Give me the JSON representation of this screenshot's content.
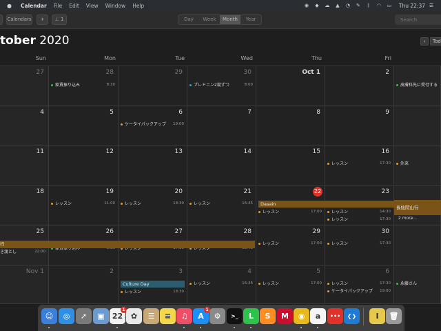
{
  "menubar": {
    "apple_icon": "apple-icon",
    "app_name": "Calendar",
    "menus": [
      "File",
      "Edit",
      "View",
      "Window",
      "Help"
    ],
    "status_icons": [
      "onepassword-icon",
      "dropbox-icon",
      "cloud-icon",
      "evernote-icon",
      "alarm-icon",
      "pen-icon",
      "bluetooth-icon",
      "wifi-icon",
      "battery-icon",
      "menu-list-icon"
    ],
    "clock": "Thu 22:37"
  },
  "toolbar": {
    "calendars_label": "Calendars",
    "add_label": "+",
    "inbox_label": "1",
    "views": [
      "Day",
      "Week",
      "Month",
      "Year"
    ],
    "active_view": "Month",
    "search_placeholder": "Search"
  },
  "header": {
    "month": "tober",
    "year": "2020",
    "today_label": "Tod",
    "prev_label": "‹"
  },
  "weekdays": [
    "Sun",
    "Mon",
    "Tue",
    "Wed",
    "Thu",
    "Fri"
  ],
  "weeks": [
    [
      "27",
      "28",
      "29",
      "30",
      "Oct 1",
      "2"
    ],
    [
      "4",
      "5",
      "6",
      "7",
      "8",
      "9"
    ],
    [
      "11",
      "12",
      "13",
      "14",
      "15",
      "16"
    ],
    [
      "18",
      "19",
      "20",
      "21",
      "22",
      "23"
    ],
    [
      "25",
      "26",
      "27",
      "28",
      "29",
      "30"
    ],
    [
      "Nov 1",
      "2",
      "3",
      "4",
      "5",
      "6"
    ]
  ],
  "today": "22",
  "colors": {
    "green": "#3fb950",
    "orange": "#e89a2c",
    "blue": "#3aa0e0",
    "brown_bar": "#7a5416",
    "teal_bar": "#2c5d6e",
    "today_red": "#e0322a"
  },
  "events": {
    "e1": {
      "title": "家賃振り込み",
      "time": "8:30"
    },
    "e2": {
      "title": "プレドニン2錠ずつ",
      "time": "8:00"
    },
    "e3": {
      "title": "皮膚科先に受付する"
    },
    "e4": {
      "title": "ケータイパックアップ",
      "time": "19:00"
    },
    "e5": {
      "title": "レッスン",
      "time": "17:30"
    },
    "e6": {
      "title": "外来"
    },
    "e7": {
      "title": "レッスン",
      "time": "11:00"
    },
    "e8": {
      "title": "レッスン",
      "time": "18:30"
    },
    "e9": {
      "title": "レッスン",
      "time": "16:45"
    },
    "dasain": {
      "title": "Dasain"
    },
    "e10": {
      "title": "レッスン",
      "time": "17:00"
    },
    "e11": {
      "title": "レッスン",
      "time": "14:30"
    },
    "e12": {
      "title": "レッスン",
      "time": "17:30"
    },
    "e13": {
      "title": "長仙院山行"
    },
    "more": "2 more...",
    "bar_w5": {
      "title": "行"
    },
    "e14": {
      "title": "き渡とし",
      "time": "22:00"
    },
    "e15": {
      "title": "家賃振り込み",
      "time": "6:30"
    },
    "e16": {
      "title": "レッスン",
      "time": "17:30"
    },
    "e17": {
      "title": "レッスン",
      "time": "16:45"
    },
    "e18": {
      "title": "レッスン",
      "time": "17:00"
    },
    "e19": {
      "title": "レッスン",
      "time": "17:30"
    },
    "culture": {
      "title": "Culture Day"
    },
    "e20": {
      "title": "レッスン",
      "time": "18:30"
    },
    "e21": {
      "title": "レッスン",
      "time": "16:45"
    },
    "e22": {
      "title": "レッスン",
      "time": "17:00"
    },
    "e23": {
      "title": "レッスン",
      "time": "17:30"
    },
    "e24": {
      "title": "ケータイパックアップ",
      "time": "19:00"
    },
    "e25": {
      "title": "永藤さん"
    }
  },
  "dock": {
    "items": [
      {
        "name": "finder-icon",
        "color": "#3b7fd9",
        "glyph": "☺"
      },
      {
        "name": "safari-icon",
        "color": "#2f8fe6",
        "glyph": "◎"
      },
      {
        "name": "launchpad-icon",
        "color": "#7a7a7a",
        "glyph": "➚"
      },
      {
        "name": "preview-icon",
        "color": "#6a9bd1",
        "glyph": "▣"
      },
      {
        "name": "calendar-icon",
        "color": "#f2f2f2",
        "glyph": "22",
        "badge": "1"
      },
      {
        "name": "photos-icon",
        "color": "#e9e9e9",
        "glyph": "✿"
      },
      {
        "name": "contacts-icon",
        "color": "#c9a877",
        "glyph": "☰"
      },
      {
        "name": "notes-icon",
        "color": "#f2d64b",
        "glyph": "≡"
      },
      {
        "name": "music-icon",
        "color": "#f04d67",
        "glyph": "♫"
      },
      {
        "name": "app-store-icon",
        "color": "#1c8ef5",
        "glyph": "A",
        "badge": "1"
      },
      {
        "name": "system-preferences-icon",
        "color": "#8a8a8a",
        "glyph": "⚙"
      },
      {
        "name": "terminal-icon",
        "color": "#111111",
        "glyph": ">_"
      },
      {
        "name": "line-icon",
        "color": "#2fc24a",
        "glyph": "L"
      },
      {
        "name": "sublime-text-icon",
        "color": "#ff8d1f",
        "glyph": "S"
      },
      {
        "name": "mcafee-icon",
        "color": "#c8102e",
        "glyph": "M"
      },
      {
        "name": "chrome-icon",
        "color": "#e8b81f",
        "glyph": "◉"
      },
      {
        "name": "script-editor-icon",
        "color": "#f5f5f5",
        "glyph": "a"
      },
      {
        "name": "more-dots-icon",
        "color": "#e0322a",
        "glyph": "•••"
      },
      {
        "name": "vscode-icon",
        "color": "#1f7bd3",
        "glyph": "❮❯"
      },
      {
        "name": "coin-icon",
        "color": "#e6c84a",
        "glyph": "I"
      },
      {
        "name": "trash-icon",
        "color": "#9a9a9a",
        "glyph": "🗑"
      }
    ]
  }
}
